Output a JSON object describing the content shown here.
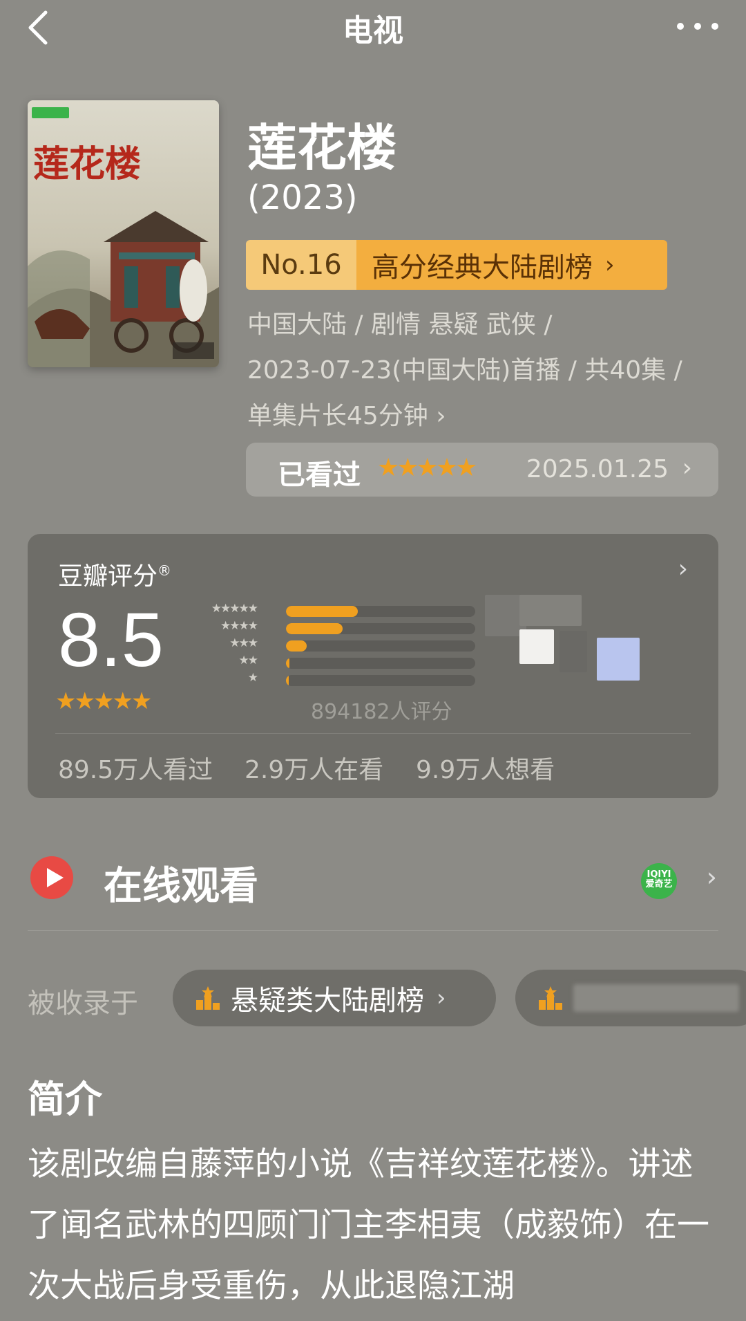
{
  "header": {
    "title": "电视",
    "back_icon": "chevron-left-icon",
    "more_icon": "more-dots-icon"
  },
  "show": {
    "title": "莲花楼",
    "year": "(2023)",
    "poster_text": "莲花楼",
    "rank": {
      "number": "No.16",
      "list_name": "高分经典大陆剧榜",
      "chevron": "›"
    },
    "meta_line_1": "中国大陆 / 剧情 悬疑 武侠 /",
    "meta_line_2": "2023-07-23(中国大陆)首播 / 共40集 /",
    "meta_line_3": "单集片长45分钟 ›"
  },
  "watched": {
    "label": "已看过",
    "stars": "★★★★★",
    "date": "2025.01.25",
    "chevron": "›"
  },
  "rating": {
    "label": "豆瓣评分",
    "registered": "®",
    "chevron": "›",
    "score": "8.5",
    "stars": "★★★★★",
    "count": "894182人评分",
    "distribution": [
      {
        "stars": "★★★★★",
        "fraction": 0.38
      },
      {
        "stars": "★★★★",
        "fraction": 0.3
      },
      {
        "stars": "★★★",
        "fraction": 0.11
      },
      {
        "stars": "★★",
        "fraction": 0.02
      },
      {
        "stars": "★",
        "fraction": 0.015
      }
    ],
    "stats": {
      "watched": "89.5万人看过",
      "watching": "2.9万人在看",
      "want": "9.9万人想看"
    }
  },
  "online": {
    "title": "在线观看",
    "provider_badge": "IQIYI 爱奇艺",
    "chevron": "›"
  },
  "collections": {
    "label": "被收录于",
    "items": [
      {
        "name": "悬疑类大陆剧榜",
        "chevron": "›"
      }
    ]
  },
  "synopsis": {
    "heading": "简介",
    "text": "该剧改编自藤萍的小说《吉祥纹莲花楼》。讲述了闻名武林的四顾门门主李相夷（成毅饰）在一次大战后身受重伤，从此退隐江湖"
  },
  "colors": {
    "background": "#8c8b86",
    "accent_orange": "#f0a020",
    "rank_badge": "#f5c978",
    "play_red": "#e84a44"
  }
}
